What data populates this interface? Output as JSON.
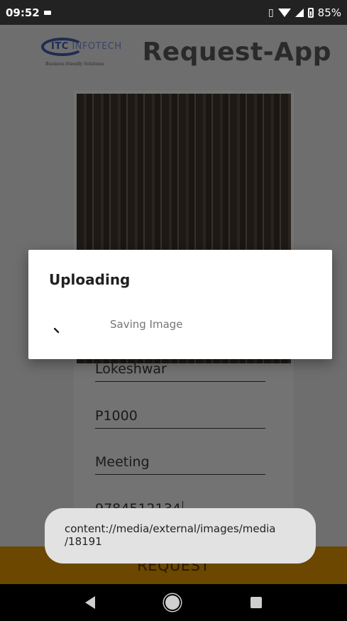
{
  "status_bar": {
    "time": "09:52",
    "battery": "85%"
  },
  "header": {
    "logo_text_bold": "ITC",
    "logo_text_light": " INFOTECH",
    "logo_tagline": "Business friendly Solutions",
    "title": "Request-App"
  },
  "form": {
    "name": "Lokeshwar",
    "employee_id": "P1000",
    "purpose": "Meeting",
    "phone": "9784512134"
  },
  "request_button": {
    "label": "REQUEST"
  },
  "dialog": {
    "title": "Uploading",
    "message": "Saving Image"
  },
  "toast": {
    "message": "content://media/external/images/media\n/18191"
  }
}
